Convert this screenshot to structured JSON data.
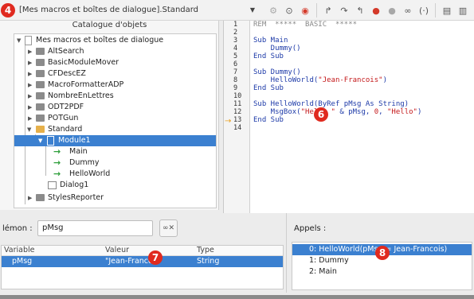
{
  "callouts": [
    "4",
    "6",
    "7",
    "8"
  ],
  "toolbar": {
    "macro_select_value": "[Mes macros et boîtes de dialogue].Standard",
    "icons": [
      "compile-icon",
      "run-icon",
      "stop-icon",
      "step-into-icon",
      "step-over-icon",
      "step-out-icon",
      "breakpoint-icon",
      "manage-breakpoints-icon",
      "watch-icon",
      "find-parentheses-icon",
      "object-catalog-icon",
      "macros-icon",
      "modules-icon"
    ]
  },
  "catalog": {
    "title": "Catalogue d'objets",
    "items": [
      {
        "label": "Mes macros et boîtes de dialogue",
        "kind": "root"
      },
      {
        "label": "AltSearch",
        "kind": "library"
      },
      {
        "label": "BasicModuleMover",
        "kind": "library"
      },
      {
        "label": "CFDescEZ",
        "kind": "library"
      },
      {
        "label": "MacroFormatterADP",
        "kind": "library"
      },
      {
        "label": "NombreEnLettres",
        "kind": "library"
      },
      {
        "label": "ODT2PDF",
        "kind": "library"
      },
      {
        "label": "POTGun",
        "kind": "library"
      },
      {
        "label": "Standard",
        "kind": "library-open"
      },
      {
        "label": "Module1",
        "kind": "module"
      },
      {
        "label": "Main",
        "kind": "sub"
      },
      {
        "label": "Dummy",
        "kind": "sub"
      },
      {
        "label": "HelloWorld",
        "kind": "sub"
      },
      {
        "label": "Dialog1",
        "kind": "dialog"
      },
      {
        "label": "StylesReporter",
        "kind": "library"
      }
    ]
  },
  "editor": {
    "line_numbers": [
      "1",
      "2",
      "3",
      "4",
      "5",
      "6",
      "7",
      "8",
      "9",
      "10",
      "11",
      "12",
      "13",
      "14"
    ],
    "current_line": "12",
    "lines": {
      "l1a": "REM",
      "l1b": "  *****  BASIC  *****",
      "l3a": "Sub",
      "l3b": " Main",
      "l4": "    Dummy()",
      "l5a": "End",
      "l5b": " Sub",
      "l7a": "Sub",
      "l7b": " Dummy()",
      "l8a": "    HelloWorld(",
      "l8b": "\"Jean-Francois\"",
      "l8c": ")",
      "l9a": "End",
      "l9b": " Sub",
      "l11a": "Sub",
      "l11b": " HelloWorld(ByRef pMsg As String)",
      "l12a": "    MsgBox(",
      "l12b": "\"Hello \"",
      "l12c": " & pMsg, ",
      "l12d": "0",
      "l12e": ", ",
      "l12f": "\"Hello\"",
      "l12g": ")",
      "l13a": "End",
      "l13b": " Sub"
    }
  },
  "watch": {
    "label": "lémon :",
    "input_value": "pMsg",
    "columns": [
      "Variable",
      "Valeur",
      "Type"
    ],
    "rows": [
      {
        "variable": "pMsg",
        "value": "\"Jean-Francois\"",
        "type": "String"
      }
    ]
  },
  "calls": {
    "label": "Appels :",
    "items": [
      "0: HelloWorld(pMsg = Jean-Francois)",
      "1: Dummy",
      "2: Main"
    ]
  }
}
